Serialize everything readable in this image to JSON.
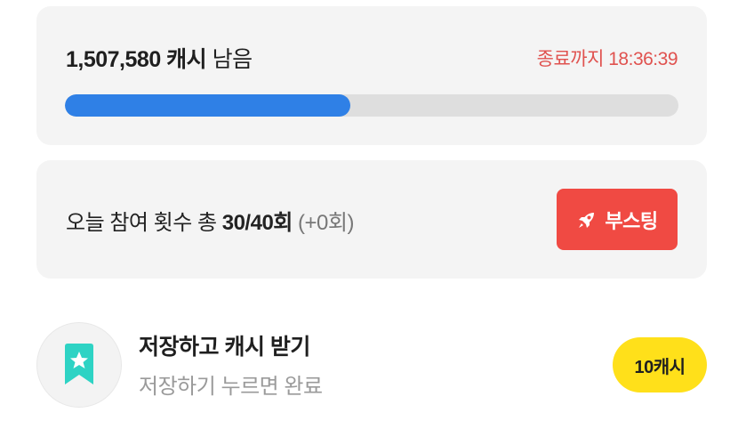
{
  "cash_card": {
    "amount": "1,507,580 캐시",
    "amount_suffix": "남음",
    "timer_text": "종료까지 18:36:39",
    "progress_fraction": 0.465,
    "progress_color": "#2f80e6"
  },
  "count_card": {
    "prefix": "오늘 참여 횟수 총 ",
    "count": "30/40회",
    "extra": "(+0회)",
    "boost_label": "부스팅",
    "boost_icon": "rocket-icon",
    "boost_color": "#f04a43"
  },
  "mission": {
    "icon": "bookmark-star-icon",
    "title": "저장하고 캐시 받기",
    "subtitle": "저장하기 누르면 완료",
    "reward": "10캐시",
    "reward_color": "#ffe01a"
  }
}
